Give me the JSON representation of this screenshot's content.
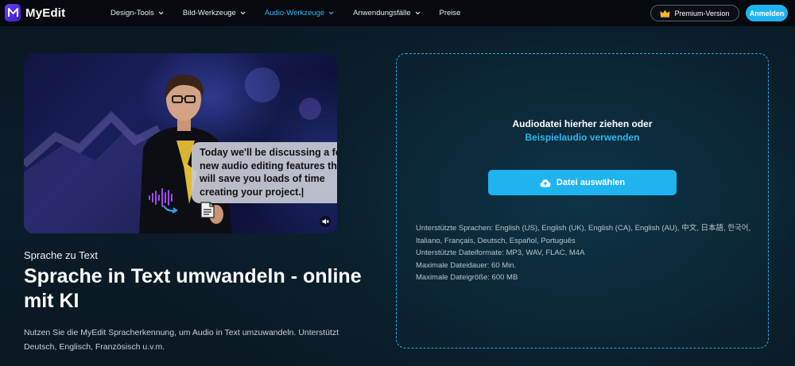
{
  "nav": {
    "logo_text": "MyEdit",
    "items": [
      {
        "label": "Design-Tools",
        "active": false
      },
      {
        "label": "Bild-Werkzeuge",
        "active": false
      },
      {
        "label": "Audio-Werkzeuge",
        "active": true
      },
      {
        "label": "Anwendungsfälle",
        "active": false
      },
      {
        "label": "Preise",
        "active": false
      }
    ],
    "premium_label": "Premium-Version",
    "login_label": "Anmelden"
  },
  "hero": {
    "bubble_text": "Today we'll be discussing a few new audio editing features that will save you loads of time creating your project.|"
  },
  "left": {
    "eyebrow": "Sprache zu Text",
    "title": "Sprache in Text umwandeln - online mit KI",
    "description": "Nutzen Sie die MyEdit Spracherkennung, um Audio in Text umzuwandeln. Unterstützt Deutsch, Englisch, Französisch u.v.m."
  },
  "dropzone": {
    "title": "Audiodatei hierher ziehen oder",
    "link": "Beispielaudio verwenden",
    "button_label": "Datei auswählen",
    "info": {
      "languages": "Unterstützte Sprachen: English (US), English (UK), English (CA), English (AU), 中文, 日本語, 한국어, Italiano, Français, Deutsch, Español, Português",
      "formats": "Unterstützte Dateiformate: MP3, WAV, FLAC, M4A",
      "duration": "Maximale Dateidauer: 60 Min.",
      "size": "Maximale Dateigröße: 600 MB"
    }
  },
  "colors": {
    "accent": "#1fb4f0",
    "active_nav": "#35b8ff",
    "logo": "#5a2ee0"
  }
}
